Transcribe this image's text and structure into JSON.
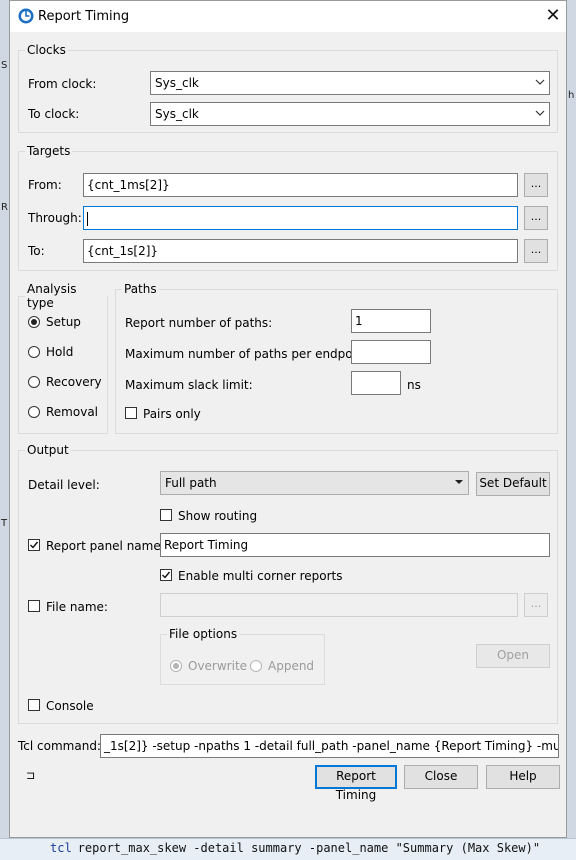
{
  "dialog": {
    "title": "Report Timing",
    "close_glyph": "✕"
  },
  "clocks": {
    "legend": "Clocks",
    "from_label": "From clock:",
    "from_value": "Sys_clk",
    "to_label": "To clock:",
    "to_value": "Sys_clk"
  },
  "targets": {
    "legend": "Targets",
    "from_label": "From:",
    "from_value": "{cnt_1ms[2]}",
    "through_label": "Through:",
    "through_value": "",
    "to_label": "To:",
    "to_value": "{cnt_1s[2]}",
    "browse_label": "..."
  },
  "analysis": {
    "legend": "Analysis type",
    "options": [
      "Setup",
      "Hold",
      "Recovery",
      "Removal"
    ],
    "selected": "Setup"
  },
  "paths": {
    "legend": "Paths",
    "report_number_label": "Report number of paths:",
    "report_number_value": "1",
    "max_per_endpoint_label": "Maximum number of paths per endpoint:",
    "max_per_endpoint_value": "",
    "max_slack_label": "Maximum slack limit:",
    "max_slack_value": "",
    "slack_unit": "ns",
    "pairs_only_label": "Pairs only",
    "pairs_only_checked": false
  },
  "output": {
    "legend": "Output",
    "detail_level_label": "Detail level:",
    "detail_level_value": "Full path",
    "set_default_label": "Set Default",
    "show_routing_label": "Show routing",
    "show_routing_checked": false,
    "report_panel_label": "Report panel name:",
    "report_panel_checked": true,
    "report_panel_value": "Report Timing",
    "multi_corner_label": "Enable multi corner reports",
    "multi_corner_checked": true,
    "file_name_label": "File name:",
    "file_name_checked": false,
    "file_name_value": "",
    "browse_label": "...",
    "file_options_legend": "File options",
    "overwrite_label": "Overwrite",
    "append_label": "Append",
    "open_label": "Open",
    "console_label": "Console",
    "console_checked": false
  },
  "tcl": {
    "label": "Tcl command:",
    "value": "_1s[2]} -setup -npaths 1 -detail full_path -panel_name {Report Timing} -multi_corner"
  },
  "footer": {
    "pin_glyph": "⊐",
    "report_timing_label": "Report Timing",
    "close_label": "Close",
    "help_label": "Help"
  },
  "background": {
    "console_keyword": "tcl",
    "console_text": "report_max_skew -detail summary -panel_name \"Summary (Max Skew)\"",
    "left_fragments": [
      "S",
      "R",
      "T"
    ],
    "right_fragment": "h"
  }
}
